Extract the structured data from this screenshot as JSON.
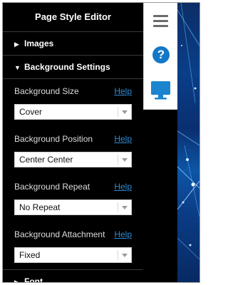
{
  "panel": {
    "title": "Page Style Editor",
    "sections": {
      "images": {
        "label": "Images"
      },
      "background": {
        "label": "Background Settings"
      },
      "font": {
        "label": "Font"
      }
    },
    "help_label": "Help",
    "settings": {
      "size": {
        "label": "Background Size",
        "value": "Cover"
      },
      "position": {
        "label": "Background Position",
        "value": "Center Center"
      },
      "repeat": {
        "label": "Background Repeat",
        "value": "No Repeat"
      },
      "attachment": {
        "label": "Background Attachment",
        "value": "Fixed"
      }
    }
  },
  "toolbar": {
    "menu_icon": "hamburger-menu-icon",
    "help_icon": "question-circle-icon",
    "help_glyph": "?",
    "preview_icon": "desktop-monitor-icon"
  },
  "colors": {
    "panel_bg": "#000000",
    "link": "#2e8bd6",
    "help_icon": "#1478c8",
    "monitor_icon": "#1a84cf"
  }
}
